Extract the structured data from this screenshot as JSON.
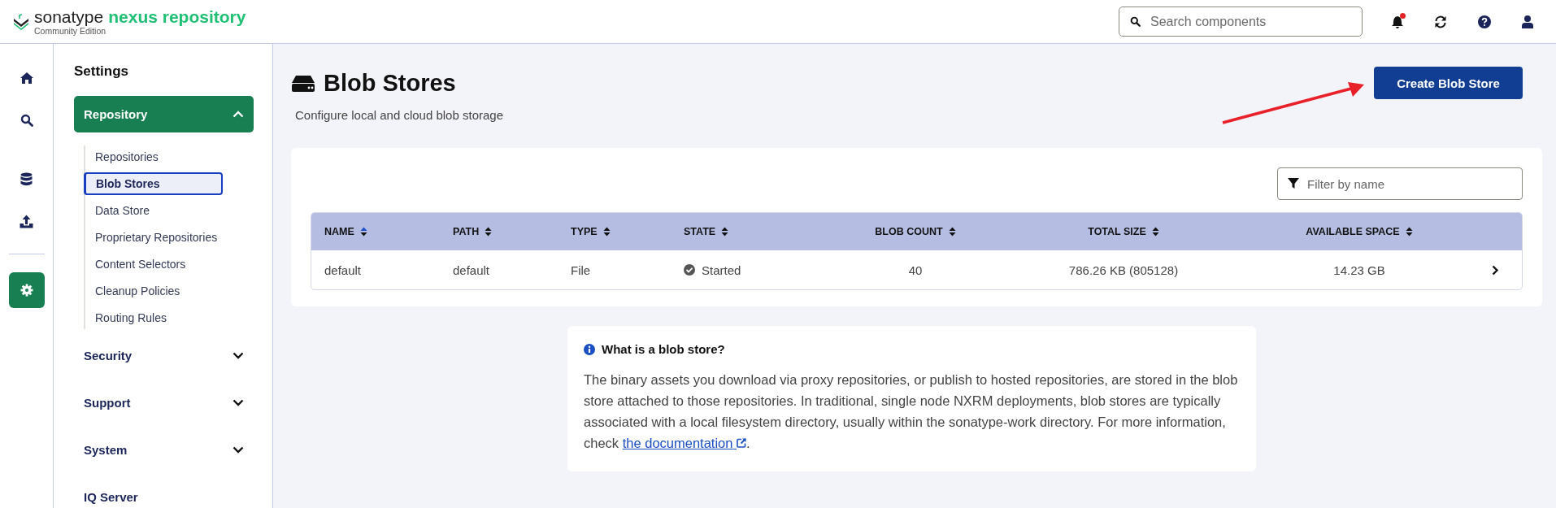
{
  "header": {
    "logo": {
      "brand": "sonatype",
      "product": "nexus repository",
      "edition": "Community Edition"
    },
    "search": {
      "placeholder": "Search components"
    },
    "notifications_unread": true
  },
  "rail": [
    {
      "kind": "home",
      "selected": false
    },
    {
      "kind": "search",
      "selected": false
    },
    {
      "kind": "database",
      "selected": false
    },
    {
      "kind": "upload",
      "selected": false
    },
    {
      "kind": "settings",
      "selected": true
    }
  ],
  "sidebar": {
    "title": "Settings",
    "sections": [
      {
        "label": "Repository",
        "kind": "group",
        "expanded": true,
        "children": [
          {
            "label": "Repositories",
            "selected": false
          },
          {
            "label": "Blob Stores",
            "selected": true
          },
          {
            "label": "Data Store",
            "selected": false
          },
          {
            "label": "Proprietary Repositories",
            "selected": false
          },
          {
            "label": "Content Selectors",
            "selected": false
          },
          {
            "label": "Cleanup Policies",
            "selected": false
          },
          {
            "label": "Routing Rules",
            "selected": false
          }
        ]
      },
      {
        "label": "Security",
        "kind": "group",
        "expanded": false
      },
      {
        "label": "Support",
        "kind": "group",
        "expanded": false
      },
      {
        "label": "System",
        "kind": "group",
        "expanded": false
      },
      {
        "label": "IQ Server",
        "kind": "link",
        "expanded": false
      }
    ]
  },
  "page": {
    "title": "Blob Stores",
    "subtitle": "Configure local and cloud blob storage",
    "create_button": "Create Blob Store"
  },
  "filter": {
    "placeholder": "Filter by name"
  },
  "table": {
    "columns": [
      {
        "label": "NAME",
        "kind": "text",
        "sorted": true
      },
      {
        "label": "PATH",
        "kind": "text",
        "sorted": false
      },
      {
        "label": "TYPE",
        "kind": "text",
        "sorted": false
      },
      {
        "label": "STATE",
        "kind": "text",
        "sorted": false
      },
      {
        "label": "BLOB COUNT",
        "kind": "number",
        "sorted": false
      },
      {
        "label": "TOTAL SIZE",
        "kind": "number",
        "sorted": false
      },
      {
        "label": "AVAILABLE SPACE",
        "kind": "number",
        "sorted": false
      }
    ],
    "rows": [
      {
        "name": "default",
        "path": "default",
        "type": "File",
        "state": "Started",
        "blob_count": "40",
        "total_size": "786.26 KB (805128)",
        "available_space": "14.23 GB"
      }
    ]
  },
  "info": {
    "title": "What is a blob store?",
    "text": "The binary assets you download via proxy repositories, or publish to hosted repositories, are stored in the blob store attached to those repositories. In traditional, single node NXRM deployments, blob stores are typically associated with a local filesystem directory, usually within the sonatype-work directory. For more information, check ",
    "link": "the documentation",
    "text_after": "."
  }
}
